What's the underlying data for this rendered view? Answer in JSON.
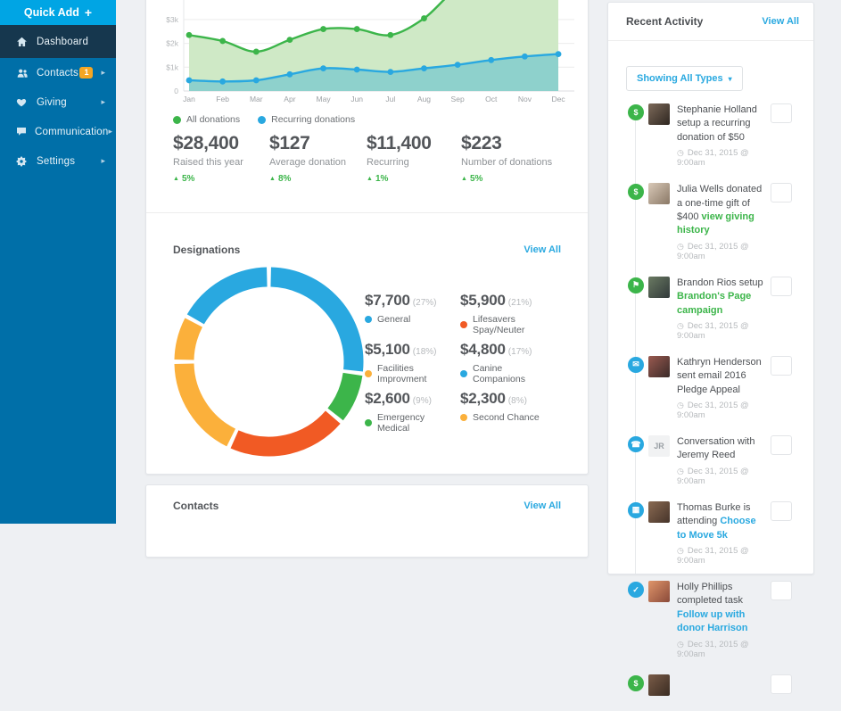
{
  "colors": {
    "sidebar_bg": "#006fa8",
    "quick_add_bg": "#00a5e4",
    "active_item_bg": "#16374e",
    "badge_bg": "#f5a623",
    "link_blue": "#2aa9e0",
    "green": "#3cb54a",
    "blue": "#29a8e0",
    "orange": "#f15a24",
    "yellow": "#fbb03b"
  },
  "sidebar": {
    "quick_add_label": "Quick Add",
    "quick_add_plus": "+",
    "items": [
      {
        "label": "Dashboard",
        "icon": "home-icon",
        "active": true,
        "badge": "",
        "has_submenu": false
      },
      {
        "label": "Contacts",
        "icon": "users-icon",
        "active": false,
        "badge": "1",
        "has_submenu": true
      },
      {
        "label": "Giving",
        "icon": "heart-icon",
        "active": false,
        "badge": "",
        "has_submenu": true
      },
      {
        "label": "Communication",
        "icon": "chat-bubble-icon",
        "active": false,
        "badge": "",
        "has_submenu": true
      },
      {
        "label": "Settings",
        "icon": "gear-icon",
        "active": false,
        "badge": "",
        "has_submenu": true
      }
    ]
  },
  "donations": {
    "stats": [
      {
        "value": "$28,400",
        "label": "Raised this year",
        "change": "5%",
        "direction": "up"
      },
      {
        "value": "$127",
        "label": "Average donation",
        "change": "8%",
        "direction": "up"
      },
      {
        "value": "$11,400",
        "label": "Recurring",
        "change": "1%",
        "direction": "up"
      },
      {
        "value": "$223",
        "label": "Number of donations",
        "change": "5%",
        "direction": "up"
      }
    ]
  },
  "designations": {
    "title": "Designations",
    "view_all_label": "View All"
  },
  "contacts": {
    "title": "Contacts",
    "view_all_label": "View All"
  },
  "activity": {
    "title": "Recent Activity",
    "view_all_label": "View All",
    "filter_label": "Showing All Types",
    "items": [
      {
        "icon": "dollar-icon",
        "icon_bg": "#3cb54a",
        "avatar": {
          "type": "photo",
          "c1": "#7d6a5a",
          "c2": "#2e2620"
        },
        "text": "Stephanie Holland setup a recurring donation of $50",
        "link": "",
        "link_color": "",
        "time": "Dec 31, 2015 @ 9:00am"
      },
      {
        "icon": "dollar-icon",
        "icon_bg": "#3cb54a",
        "avatar": {
          "type": "photo",
          "c1": "#d9c9b8",
          "c2": "#8a7866"
        },
        "text": "Julia Wells donated a one-time gift of $400",
        "link": "view giving history",
        "link_color": "#3cb54a",
        "time": "Dec 31, 2015 @ 9:00am"
      },
      {
        "icon": "megaphone-icon",
        "icon_bg": "#3cb54a",
        "avatar": {
          "type": "photo",
          "c1": "#6a7a62",
          "c2": "#31393a"
        },
        "text": "Brandon Rios setup",
        "link": "Brandon's Page campaign",
        "link_color": "#3cb54a",
        "time": "Dec 31, 2015 @ 9:00am"
      },
      {
        "icon": "envelope-icon",
        "icon_bg": "#29a8e0",
        "avatar": {
          "type": "photo",
          "c1": "#9a5a50",
          "c2": "#3a2a28"
        },
        "text": "Kathryn Henderson sent email 2016 Pledge Appeal",
        "link": "",
        "link_color": "",
        "time": "Dec 31, 2015 @ 9:00am"
      },
      {
        "icon": "phone-icon",
        "icon_bg": "#29a8e0",
        "avatar": {
          "type": "initials",
          "text": "JR"
        },
        "text": "Conversation with Jeremy Reed",
        "link": "",
        "link_color": "",
        "time": "Dec 31, 2015 @ 9:00am"
      },
      {
        "icon": "calendar-icon",
        "icon_bg": "#29a8e0",
        "avatar": {
          "type": "photo",
          "c1": "#8a6a52",
          "c2": "#46342a"
        },
        "text": "Thomas Burke is attending",
        "link": "Choose to Move 5k",
        "link_color": "#2aa9e0",
        "time": "Dec 31, 2015 @ 9:00am"
      },
      {
        "icon": "task-icon",
        "icon_bg": "#29a8e0",
        "avatar": {
          "type": "photo",
          "c1": "#e0956a",
          "c2": "#8a4a3a"
        },
        "text": "Holly Phillips completed task",
        "link": "Follow up with donor Harrison",
        "link_color": "#2aa9e0",
        "time": "Dec 31, 2015 @ 9:00am"
      },
      {
        "icon": "dollar-icon",
        "icon_bg": "#3cb54a",
        "avatar": {
          "type": "photo",
          "c1": "#7a5c48",
          "c2": "#3a2c22"
        },
        "text": "",
        "link": "",
        "link_color": "",
        "time": ""
      }
    ]
  },
  "icon_glyphs": {
    "dollar-icon": "$",
    "megaphone-icon": "⚑",
    "envelope-icon": "✉",
    "phone-icon": "☎",
    "calendar-icon": "▦",
    "task-icon": "✓",
    "clock-icon": "◷",
    "chevron-down-icon": "▾",
    "chevron-right-icon": "▸",
    "up-arrow-icon": "▲"
  },
  "chart_data": [
    {
      "type": "area",
      "title": "Donations by month (top of chart clipped by viewport)",
      "x": [
        "Jan",
        "Feb",
        "Mar",
        "Apr",
        "May",
        "Jun",
        "Jul",
        "Aug",
        "Sep",
        "Oct",
        "Nov",
        "Dec"
      ],
      "y_tick_labels": [
        "0",
        "$1k",
        "$2k",
        "$3k"
      ],
      "y_unit": "$k",
      "ylim_visible": [
        0,
        3.8
      ],
      "grid": true,
      "legend_position": "bottom-left",
      "series": [
        {
          "name": "All donations",
          "color": "#3cb54a",
          "fill": "#cfe9c6",
          "values": [
            2.35,
            2.1,
            1.65,
            2.15,
            2.6,
            2.6,
            2.35,
            3.05,
            4.3,
            4.6,
            4.75,
            4.85
          ]
        },
        {
          "name": "Recurring donations",
          "color": "#29a8e0",
          "fill": "#8ed1cc",
          "values": [
            0.45,
            0.4,
            0.45,
            0.7,
            0.95,
            0.9,
            0.8,
            0.95,
            1.1,
            1.3,
            1.45,
            1.55
          ]
        }
      ]
    },
    {
      "type": "pie",
      "style": "donut",
      "title": "Designations",
      "segments": [
        {
          "label": "General",
          "value": 7700,
          "pct": 27,
          "color": "#29a8e0"
        },
        {
          "label": "Emergency Medical",
          "value": 2600,
          "pct": 9,
          "color": "#3cb54a"
        },
        {
          "label": "Lifesavers Spay/Neuter",
          "value": 5900,
          "pct": 21,
          "color": "#f15a24"
        },
        {
          "label": "Facilities Improvment",
          "value": 5100,
          "pct": 18,
          "color": "#fbb03b"
        },
        {
          "label": "Second Chance",
          "value": 2300,
          "pct": 8,
          "color": "#fbb03b"
        },
        {
          "label": "Canine Companions",
          "value": 4800,
          "pct": 17,
          "color": "#29a8e0"
        }
      ],
      "legend_display_order": [
        0,
        2,
        3,
        5,
        1,
        4
      ]
    }
  ]
}
